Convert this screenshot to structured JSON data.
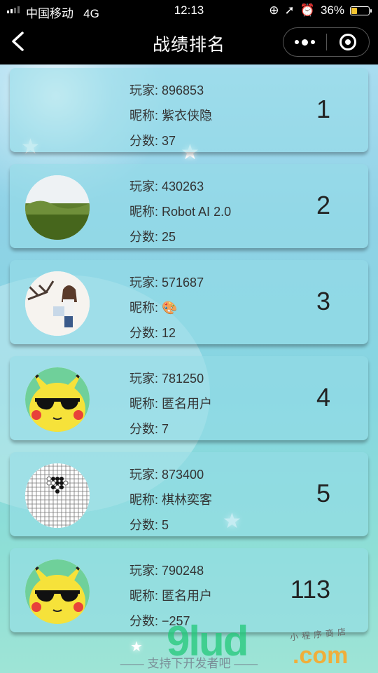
{
  "status_bar": {
    "carrier": "中国移动",
    "network": "4G",
    "time": "12:13",
    "battery": "36%",
    "battery_level": 0.36
  },
  "nav": {
    "title": "战绩排名",
    "back_icon": "chevron-left-icon",
    "more_icon": "more-dots-icon",
    "close_icon": "target-circle-icon"
  },
  "labels": {
    "player": "玩家: ",
    "nickname": "昵称: ",
    "score": "分数: "
  },
  "rankings": [
    {
      "player_id": "896853",
      "nickname": "紫衣侠隐",
      "score": "37",
      "rank": "1",
      "avatar": "none"
    },
    {
      "player_id": "430263",
      "nickname": "Robot AI 2.0",
      "score": "25",
      "rank": "2",
      "avatar": "grass-field-photo"
    },
    {
      "player_id": "571687",
      "nickname": "🎨",
      "score": "12",
      "rank": "3",
      "avatar": "painting-girl-photo"
    },
    {
      "player_id": "781250",
      "nickname": "匿名用户",
      "score": "7",
      "rank": "4",
      "avatar": "pikachu-sunglasses"
    },
    {
      "player_id": "873400",
      "nickname": "棋林奕客",
      "score": "5",
      "rank": "5",
      "avatar": "go-board"
    },
    {
      "player_id": "790248",
      "nickname": "匿名用户",
      "score": "−257",
      "rank": "113",
      "avatar": "pikachu-sunglasses"
    }
  ],
  "footer": {
    "text": "—— 支持下开发者吧 ——"
  },
  "watermark": {
    "brand": "9lud",
    "domain": ".com",
    "tagline": "小程序商店"
  }
}
